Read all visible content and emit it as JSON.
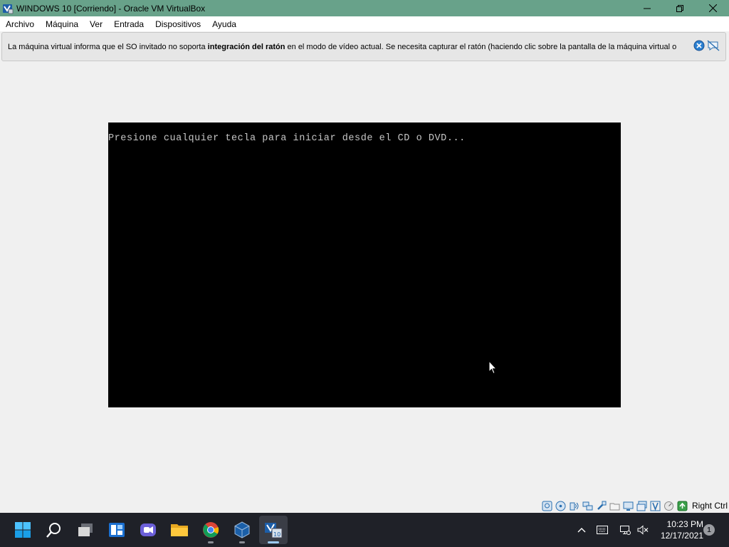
{
  "window": {
    "title": "WINDOWS 10 [Corriendo] - Oracle VM VirtualBox",
    "app_icon": "virtualbox-icon",
    "controls": [
      "minimize-icon",
      "maximize-icon",
      "close-icon"
    ]
  },
  "menubar": {
    "items": [
      "Archivo",
      "Máquina",
      "Ver",
      "Entrada",
      "Dispositivos",
      "Ayuda"
    ]
  },
  "notification": {
    "text_before": "La máquina virtual informa que el SO invitado no soporta ",
    "text_bold": "integración del ratón",
    "text_after": " en el modo de vídeo actual. Se necesita capturar el ratón (haciendo clic sobre la pantalla de la máquina virtual o",
    "icons": [
      "close-message-icon",
      "do-not-show-again-icon"
    ]
  },
  "vm_screen": {
    "console_text": "Presione cualquier tecla para iniciar desde el CD o DVD..."
  },
  "statusbar": {
    "icons": [
      "hard-disk-icon",
      "optical-drive-icon",
      "audio-icon",
      "network-icon",
      "usb-icon",
      "shared-folders-icon",
      "display-icon",
      "recording-icon",
      "mouse-integration-icon",
      "cpu-icon",
      "host-key-arrow-icon"
    ],
    "host_key": "Right Ctrl"
  },
  "taskbar": {
    "apps": [
      "start-icon",
      "search-icon",
      "task-view-icon",
      "widgets-icon",
      "chat-icon",
      "file-explorer-icon",
      "chrome-icon",
      "virtualbox-manager-icon",
      "virtualbox-vm-icon"
    ],
    "tray_icons": [
      "chevron-up-icon",
      "keyboard-icon",
      "network-icon",
      "volume-muted-icon"
    ],
    "time": "10:23 PM",
    "date": "12/17/2021",
    "notification_count": "1"
  },
  "colors": {
    "titlebar": "#68a28a",
    "taskbar": "#1f2128",
    "vm_background": "#000000",
    "console_text": "#c6c6c6"
  }
}
